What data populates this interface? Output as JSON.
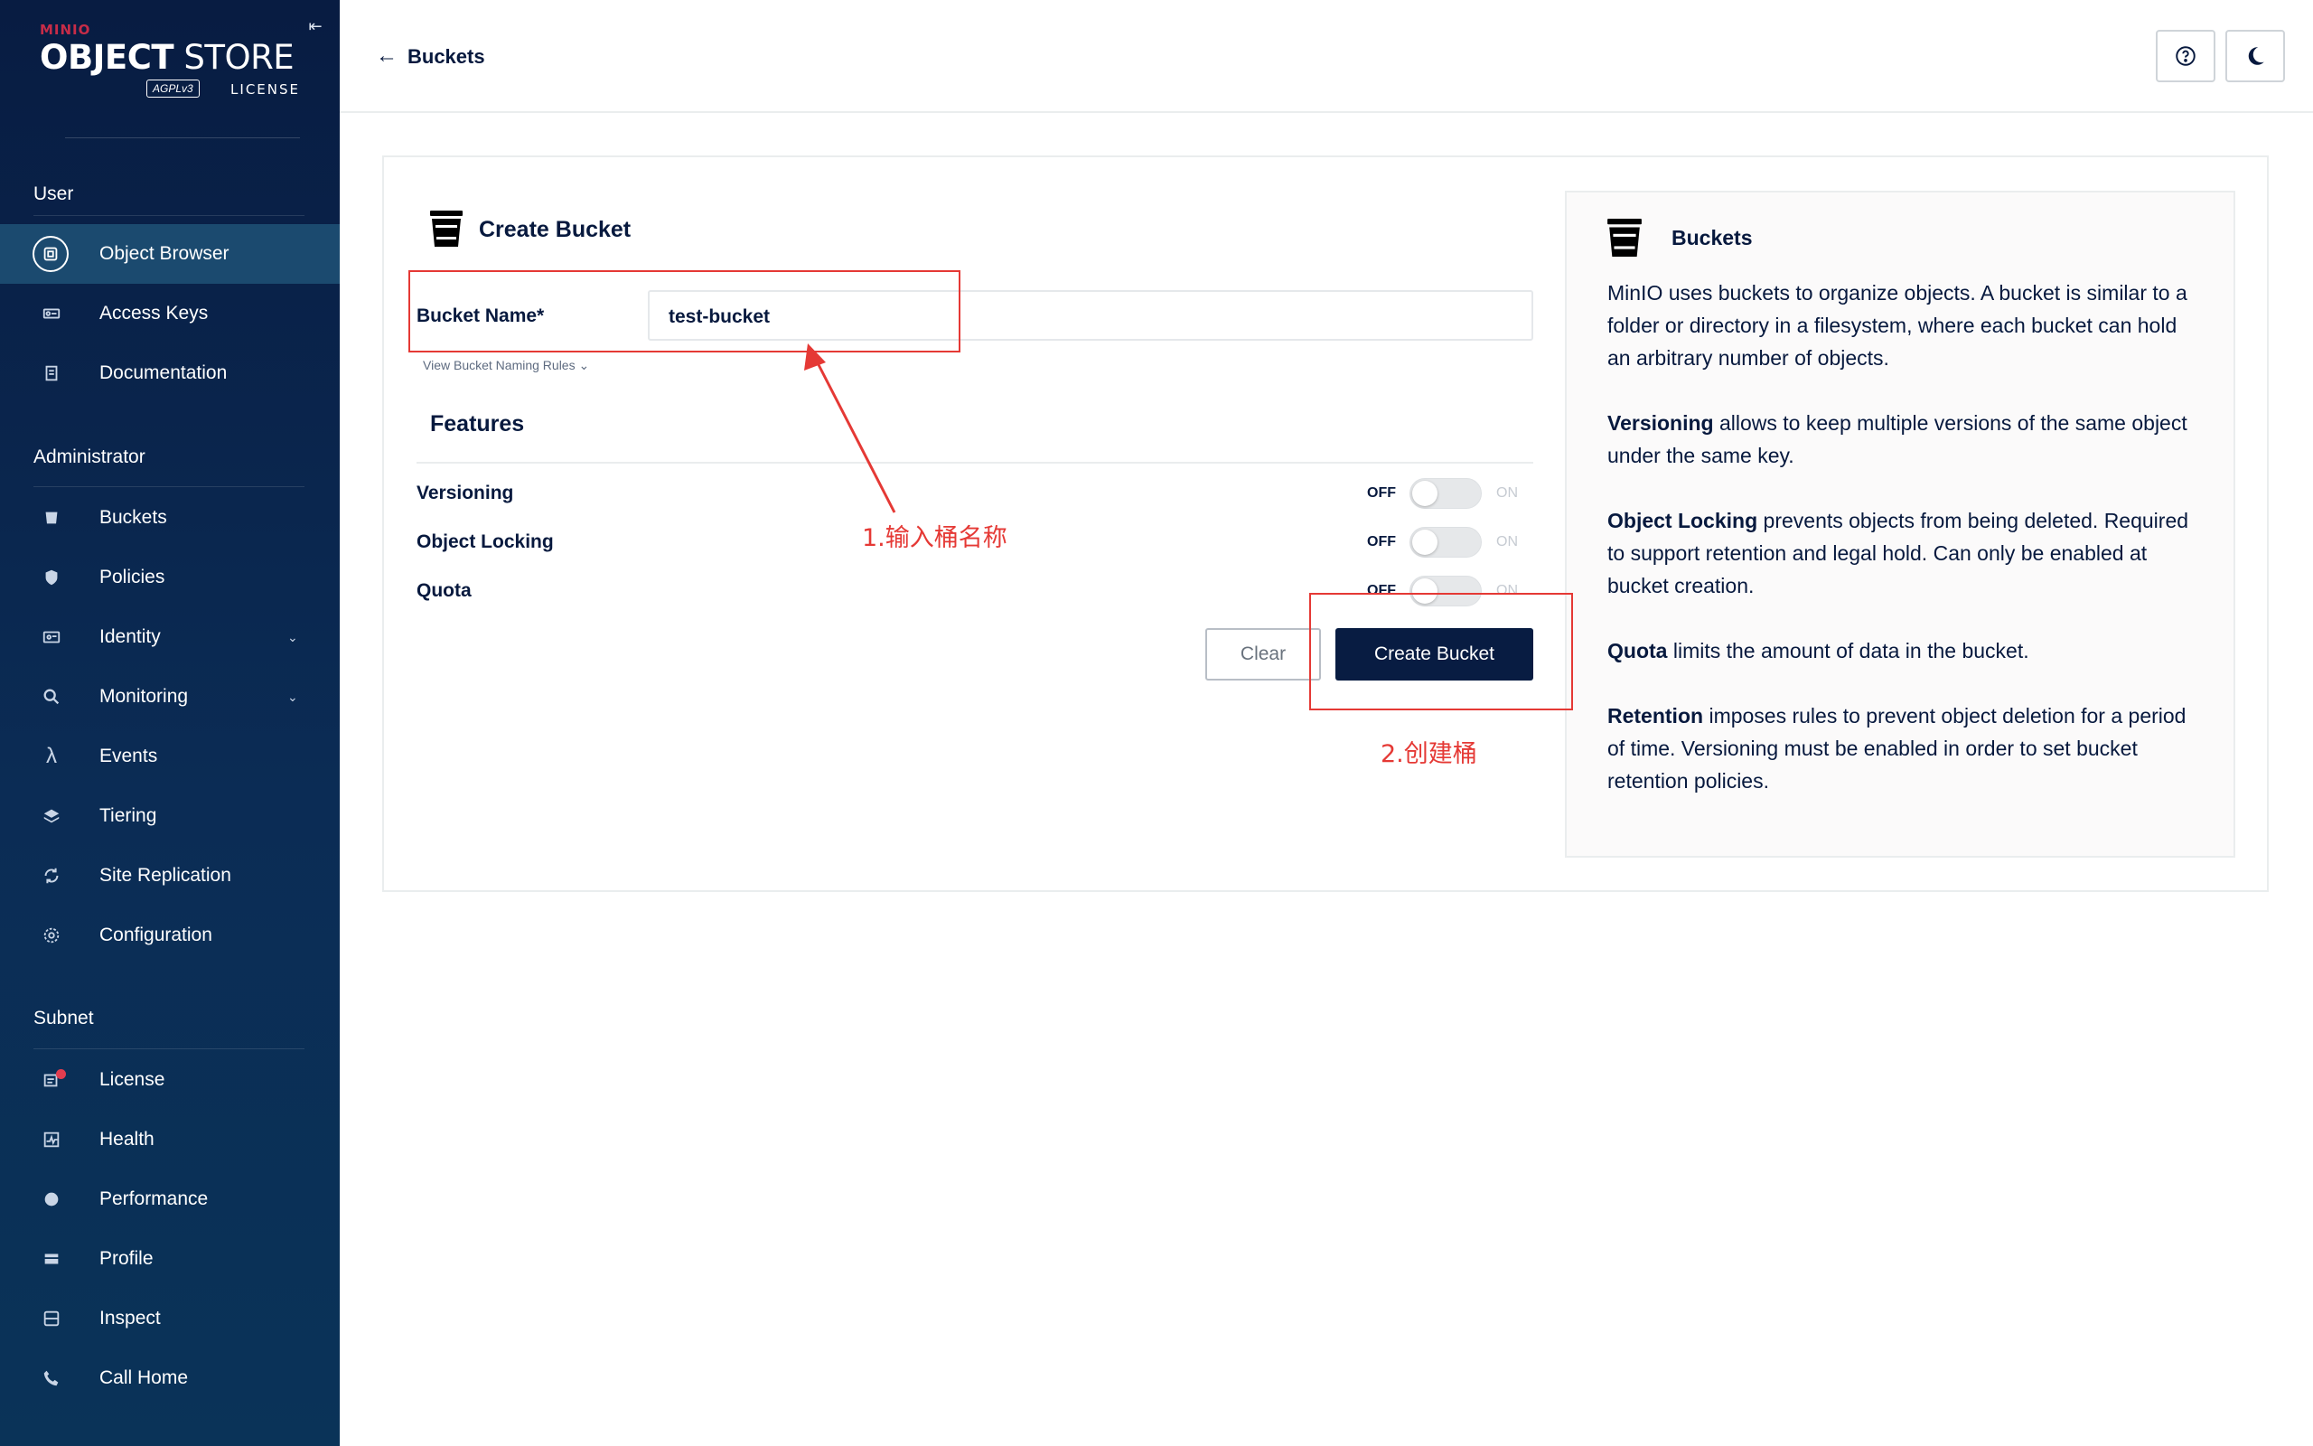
{
  "brand": {
    "minio": "MINIO",
    "object": "OBJECT",
    "store": " STORE",
    "agpl": "AGPLv3",
    "license": "LICENSE"
  },
  "sidebar": {
    "sections": [
      {
        "title": "User",
        "items": [
          {
            "label": "Object Browser",
            "icon": "object-browser-icon",
            "active": true
          },
          {
            "label": "Access Keys",
            "icon": "access-keys-icon"
          },
          {
            "label": "Documentation",
            "icon": "documentation-icon"
          }
        ]
      },
      {
        "title": "Administrator",
        "items": [
          {
            "label": "Buckets",
            "icon": "buckets-icon"
          },
          {
            "label": "Policies",
            "icon": "policies-icon"
          },
          {
            "label": "Identity",
            "icon": "identity-icon",
            "expandable": true
          },
          {
            "label": "Monitoring",
            "icon": "monitoring-icon",
            "expandable": true
          },
          {
            "label": "Events",
            "icon": "lambda-icon"
          },
          {
            "label": "Tiering",
            "icon": "tiering-icon"
          },
          {
            "label": "Site Replication",
            "icon": "site-replication-icon"
          },
          {
            "label": "Configuration",
            "icon": "gear-icon"
          }
        ]
      },
      {
        "title": "Subnet",
        "items": [
          {
            "label": "License",
            "icon": "license-icon",
            "badge": true
          },
          {
            "label": "Health",
            "icon": "health-icon"
          },
          {
            "label": "Performance",
            "icon": "performance-icon"
          },
          {
            "label": "Profile",
            "icon": "profile-icon"
          },
          {
            "label": "Inspect",
            "icon": "inspect-icon"
          },
          {
            "label": "Call Home",
            "icon": "call-home-icon"
          }
        ]
      }
    ]
  },
  "header": {
    "back_label": "Buckets",
    "help_icon": "help-icon",
    "theme_icon": "dark-mode-icon"
  },
  "form": {
    "title": "Create Bucket",
    "bucket_name_label": "Bucket Name*",
    "bucket_name_value": "test-bucket",
    "naming_rules": "View Bucket Naming Rules",
    "features_title": "Features",
    "features": [
      {
        "label": "Versioning",
        "off": "OFF",
        "on": "ON",
        "enabled": false
      },
      {
        "label": "Object Locking",
        "off": "OFF",
        "on": "ON",
        "enabled": false
      },
      {
        "label": "Quota",
        "off": "OFF",
        "on": "ON",
        "enabled": false
      }
    ],
    "clear_label": "Clear",
    "create_label": "Create Bucket"
  },
  "help": {
    "title": "Buckets",
    "intro": "MinIO uses buckets to organize objects. A bucket is similar to a folder or directory in a filesystem, where each bucket can hold an arbitrary number of objects.",
    "versioning_term": "Versioning",
    "versioning_text": " allows to keep multiple versions of the same object under the same key.",
    "locking_term": "Object Locking",
    "locking_text": " prevents objects from being deleted. Required to support retention and legal hold. Can only be enabled at bucket creation.",
    "quota_term": "Quota",
    "quota_text": " limits the amount of data in the bucket.",
    "retention_term": "Retention",
    "retention_text": " imposes rules to prevent object deletion for a period of time. Versioning must be enabled in order to set bucket retention policies."
  },
  "annotations": {
    "step1": "1.输入桶名称",
    "step2": "2.创建桶",
    "color": "#e53935"
  }
}
